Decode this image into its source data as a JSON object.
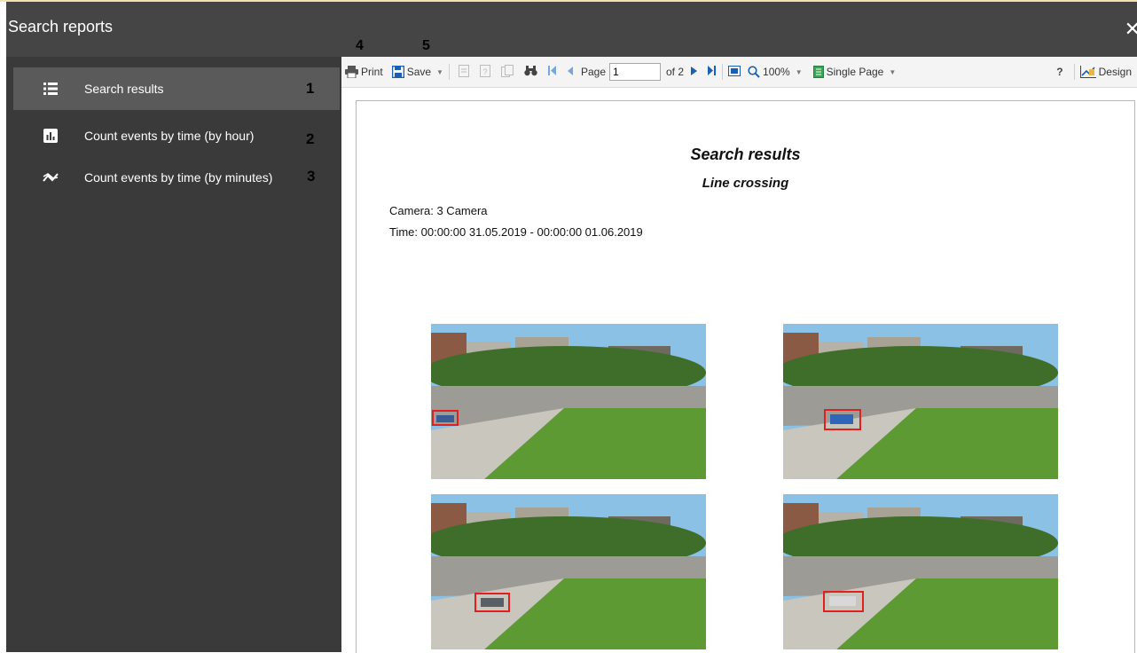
{
  "window": {
    "title": "Search reports",
    "close_icon": "close-icon"
  },
  "sidebar": {
    "items": [
      {
        "label": "Search results",
        "icon": "list-icon",
        "callout": "1",
        "active": true
      },
      {
        "label": "Count events by time (by hour)",
        "icon": "bar-chart-icon",
        "callout": "2",
        "active": false
      },
      {
        "label": "Count events by time (by minutes)",
        "icon": "trend-icon",
        "callout": "3",
        "active": false
      }
    ]
  },
  "callouts": {
    "print": "4",
    "save": "5"
  },
  "toolbar": {
    "print_label": "Print",
    "save_label": "Save",
    "page_label": "Page",
    "page_value": "1",
    "page_of": "of 2",
    "zoom_label": "100%",
    "view_mode_label": "Single Page",
    "help_label": "?",
    "design_label": "Design"
  },
  "report": {
    "title": "Search results",
    "subtitle": "Line crossing",
    "camera": "Camera: 3 Camera",
    "time": "Time: 00:00:00 31.05.2019 - 00:00:00 01.06.2019"
  },
  "colors": {
    "window_bg": "#454545",
    "sidebar_bg": "#3a3a3a",
    "active_item": "#5a5a5a",
    "highlight_box": "#e02020"
  }
}
